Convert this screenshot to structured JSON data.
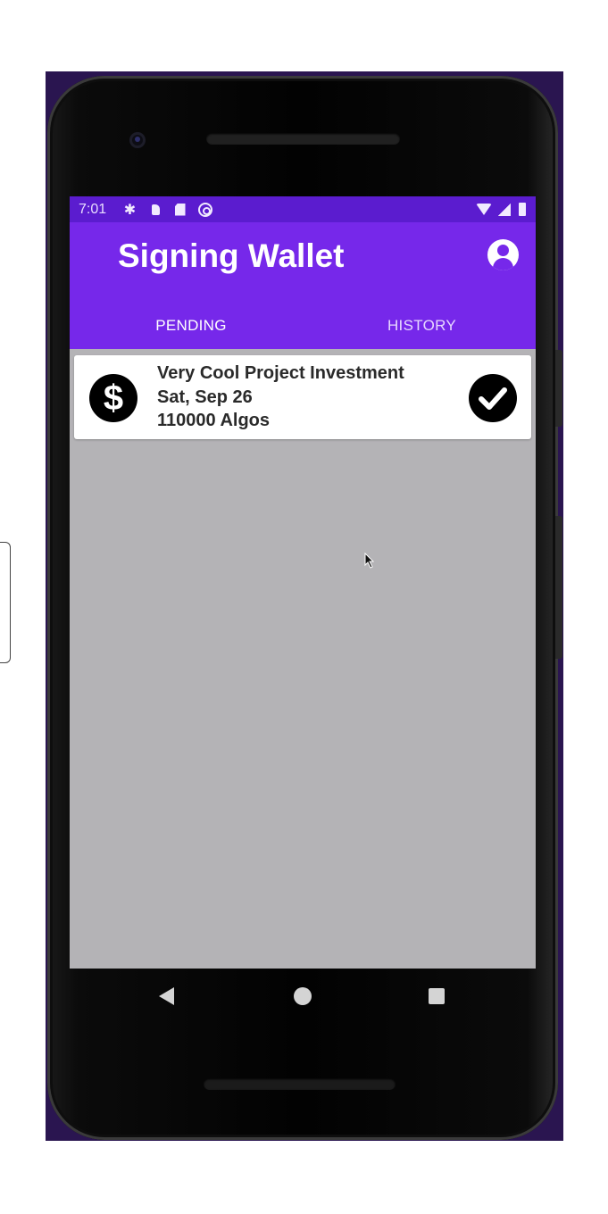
{
  "status_bar": {
    "time": "7:01",
    "icons": [
      "settings-icon",
      "notification-icon",
      "sd-card-icon",
      "sync-icon",
      "wifi-icon",
      "signal-icon",
      "battery-icon"
    ]
  },
  "app_bar": {
    "title": "Signing Wallet",
    "account_icon": "account-circle-icon"
  },
  "tabs": [
    {
      "label": "PENDING",
      "selected": true
    },
    {
      "label": "HISTORY",
      "selected": false
    }
  ],
  "pending_transactions": [
    {
      "icon": "dollar-icon",
      "title": "Very Cool Project Investment",
      "date": "Sat, Sep 26",
      "amount": "110000 Algos",
      "action_icon": "check-circle-icon"
    }
  ],
  "nav_bar": {
    "icons": [
      "back-icon",
      "home-icon",
      "recent-apps-icon"
    ]
  },
  "colors": {
    "status_bar": "#5b1ccf",
    "app_bar": "#7628ea",
    "tab_indicator": "#5ea8e8",
    "list_background": "#b4b3b6",
    "card": "#ffffff"
  }
}
